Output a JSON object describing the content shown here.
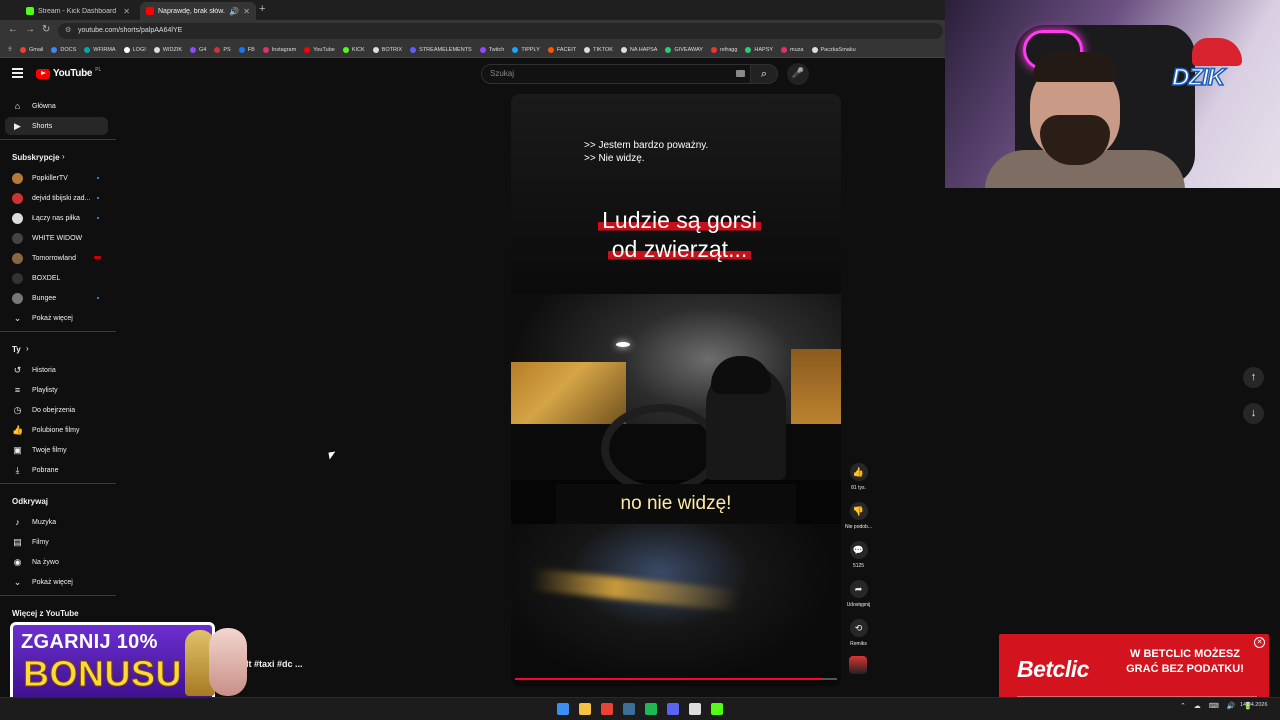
{
  "browser": {
    "tabs": [
      {
        "label": "Stream - Kick Dashboard",
        "color": "#53fc18"
      },
      {
        "label": "Naprawdę, brak słów... #u",
        "color": "#ff0000"
      }
    ],
    "url": "youtube.com/shorts/palpAA64lYE",
    "bookmarks": [
      {
        "label": "Gmail",
        "color": "#ea4335"
      },
      {
        "label": "DOCS",
        "color": "#4285f4"
      },
      {
        "label": "WFIRMA",
        "color": "#0aa"
      },
      {
        "label": "LOGI",
        "color": "#fff"
      },
      {
        "label": "WIDZIK",
        "color": "#ddd"
      },
      {
        "label": "G4",
        "color": "#9146ff"
      },
      {
        "label": "PS",
        "color": "#c33"
      },
      {
        "label": "FB",
        "color": "#1877f2"
      },
      {
        "label": "Instagram",
        "color": "#e1306c"
      },
      {
        "label": "YouTube",
        "color": "#ff0000"
      },
      {
        "label": "KICK",
        "color": "#53fc18"
      },
      {
        "label": "BOTRIX",
        "color": "#ddd"
      },
      {
        "label": "STREAMELEMENTS",
        "color": "#5f5fff"
      },
      {
        "label": "Twitch",
        "color": "#9146ff"
      },
      {
        "label": "TIPPLY",
        "color": "#1aa3ff"
      },
      {
        "label": "FACEIT",
        "color": "#ff5500"
      },
      {
        "label": "TIKTOK",
        "color": "#ddd"
      },
      {
        "label": "NA HAPSA",
        "color": "#ddd"
      },
      {
        "label": "GIVEAWAY",
        "color": "#2ecc71"
      },
      {
        "label": "refragg",
        "color": "#e33"
      },
      {
        "label": "HAPSY",
        "color": "#2ecc71"
      },
      {
        "label": "muza",
        "color": "#e3306c"
      },
      {
        "label": "PaczkaSmaku",
        "color": "#ddd"
      }
    ]
  },
  "youtube": {
    "logo_text": "YouTube",
    "country_code": "PL",
    "search_placeholder": "Szukaj",
    "sidebar": {
      "main": [
        {
          "label": "Główna",
          "icon": "home-icon",
          "glyph": "⌂"
        },
        {
          "label": "Shorts",
          "icon": "shorts-icon",
          "glyph": "▶"
        }
      ],
      "subscriptions_header": "Subskrypcje",
      "subscriptions": [
        {
          "label": "PopkillerTV",
          "color": "#b57a3a",
          "live": "dot"
        },
        {
          "label": "dejvid tibijski zad...",
          "color": "#c33",
          "live": "dot"
        },
        {
          "label": "Łączy nas piłka",
          "color": "#ddd",
          "live": "dot"
        },
        {
          "label": "WHITE WIDOW",
          "color": "#444",
          "live": "none"
        },
        {
          "label": "Tomorrowland",
          "color": "#886644",
          "live": "red"
        },
        {
          "label": "BOXDEL",
          "color": "#333",
          "live": "none"
        },
        {
          "label": "Bungee",
          "color": "#777",
          "live": "dot"
        }
      ],
      "show_more": "Pokaż więcej",
      "you_header": "Ty",
      "you": [
        {
          "label": "Historia",
          "icon": "history-icon",
          "glyph": "↺"
        },
        {
          "label": "Playlisty",
          "icon": "playlist-icon",
          "glyph": "≡"
        },
        {
          "label": "Do obejrzenia",
          "icon": "watch-later-icon",
          "glyph": "◷"
        },
        {
          "label": "Polubione filmy",
          "icon": "like-icon",
          "glyph": "👍"
        },
        {
          "label": "Twoje filmy",
          "icon": "your-videos-icon",
          "glyph": "▣"
        },
        {
          "label": "Pobrane",
          "icon": "download-icon",
          "glyph": "⤓"
        }
      ],
      "explore_header": "Odkrywaj",
      "explore": [
        {
          "label": "Muzyka",
          "icon": "music-icon",
          "glyph": "♪"
        },
        {
          "label": "Filmy",
          "icon": "movies-icon",
          "glyph": "▤"
        },
        {
          "label": "Na żywo",
          "icon": "live-icon",
          "glyph": "◉"
        },
        {
          "label": "Pokaż więcej",
          "icon": "chevron-down-icon",
          "glyph": "⌄"
        }
      ],
      "more_header": "Więcej z YouTube"
    },
    "short": {
      "subtitle_top": [
        ">> Jestem bardzo poważny.",
        ">> Nie widzę."
      ],
      "title_lines": [
        "Ludzie są gorsi",
        "od zwierząt..."
      ],
      "subtitle_bottom": "no nie widzę!",
      "progress": 0.95,
      "bottom_title": "uber #bolt #taxi #dc ..."
    },
    "actions": [
      {
        "name": "like",
        "icon": "like-icon",
        "glyph": "👍",
        "label": "81 tys."
      },
      {
        "name": "dislike",
        "icon": "dislike-icon",
        "glyph": "👎",
        "label": "Nie podob..."
      },
      {
        "name": "comments",
        "icon": "comment-icon",
        "glyph": "💬",
        "label": "5125"
      },
      {
        "name": "share",
        "icon": "share-icon",
        "glyph": "➦",
        "label": "Udostępnij"
      },
      {
        "name": "remix",
        "icon": "remix-icon",
        "glyph": "⟲",
        "label": "Remiks"
      }
    ]
  },
  "overlays": {
    "webcam_logo": "DZIK",
    "bonus_line1": "ZGARNIJ 10%",
    "bonus_line2": "BONUSU",
    "betclic_brand": "Betclic",
    "betclic_message": "W BETCLIC MOŻESZ GRAĆ BEZ PODATKU!"
  },
  "taskbar": {
    "date": "14.04.2026",
    "apps": [
      {
        "name": "start",
        "color": "#3c8ef3"
      },
      {
        "name": "explorer",
        "color": "#f5c242"
      },
      {
        "name": "chrome",
        "color": "#e94335"
      },
      {
        "name": "steam",
        "color": "#3a6f9a"
      },
      {
        "name": "spotify",
        "color": "#1db954"
      },
      {
        "name": "discord",
        "color": "#5865f2"
      },
      {
        "name": "obs",
        "color": "#ddd"
      },
      {
        "name": "kick",
        "color": "#53fc18"
      }
    ]
  }
}
